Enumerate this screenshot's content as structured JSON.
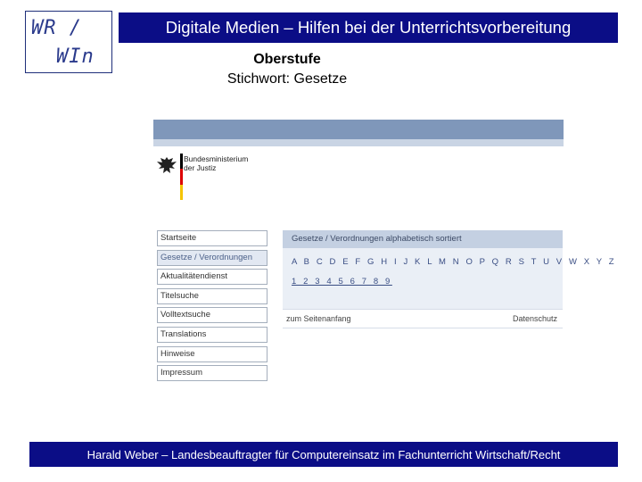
{
  "logo": {
    "line1": "WR /",
    "line2": "WIn"
  },
  "header": {
    "title": "Digitale Medien – Hilfen bei der Unterrichtsvorbereitung",
    "subtitle": "Oberstufe",
    "keyword": "Stichwort: Gesetze"
  },
  "screenshot": {
    "ministry": {
      "line1": "Bundesministerium",
      "line2": "der Justiz"
    },
    "nav": [
      {
        "label": "Startseite",
        "active": false
      },
      {
        "label": "Gesetze / Verordnungen",
        "active": true
      },
      {
        "label": "Aktualitätendienst",
        "active": false
      },
      {
        "label": "Titelsuche",
        "active": false
      },
      {
        "label": "Volltextsuche",
        "active": false
      },
      {
        "label": "Translations",
        "active": false
      },
      {
        "label": "Hinweise",
        "active": false
      },
      {
        "label": "Impressum",
        "active": false
      }
    ],
    "panel_title": "Gesetze / Verordnungen alphabetisch sortiert",
    "alphabet": "A B C D E F G H I J K L M N O P Q R S T U V W X Y Z",
    "digits": "1 2 3 4 5 6 7 8 9",
    "bottom_left": "zum Seitenanfang",
    "bottom_right": "Datenschutz"
  },
  "footer": "Harald Weber – Landesbeauftragter für Computereinsatz im Fachunterricht Wirtschaft/Recht"
}
